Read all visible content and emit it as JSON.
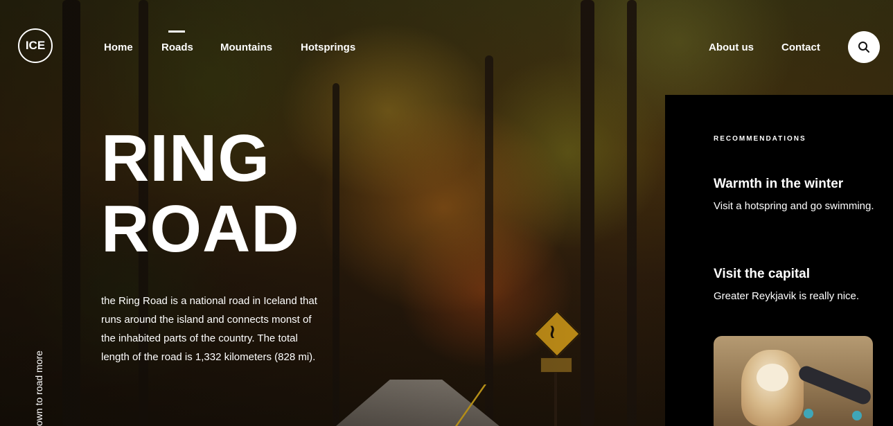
{
  "logo": {
    "text": "ICE"
  },
  "nav": {
    "left": [
      {
        "label": "Home"
      },
      {
        "label": "Roads",
        "active": true
      },
      {
        "label": "Mountains"
      },
      {
        "label": "Hotsprings"
      }
    ],
    "right": [
      {
        "label": "About us"
      },
      {
        "label": "Contact"
      }
    ]
  },
  "search": {
    "icon": "search-icon"
  },
  "hero": {
    "title_line1": "RING",
    "title_line2": "ROAD",
    "description": "the Ring Road is a national road in Iceland that runs around the island and connects monst of the inhabited parts of the country. The total length of the road is 1,332 kilometers (828 mi).",
    "scroll_hint": "own to road more"
  },
  "recommendations": {
    "heading": "RECOMMENDATIONS",
    "items": [
      {
        "title": "Warmth in the winter",
        "text": "Visit a hotspring and go swimming."
      },
      {
        "title": "Visit the capital",
        "text": "Greater Reykjavik is really nice."
      }
    ]
  },
  "colors": {
    "panel": "#000000",
    "text": "#ffffff",
    "search_bg": "#ffffff"
  }
}
